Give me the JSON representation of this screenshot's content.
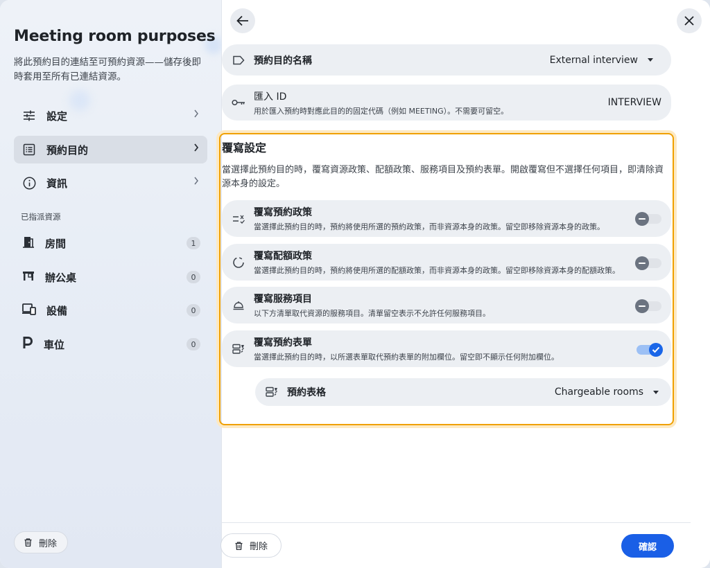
{
  "sidebar": {
    "title": "Meeting room purposes",
    "description": "將此預約目的連結至可預約資源——儲存後即時套用至所有已連結資源。",
    "nav": [
      {
        "label": "設定",
        "icon": "sliders-icon"
      },
      {
        "label": "預約目的",
        "icon": "list-icon"
      },
      {
        "label": "資訊",
        "icon": "info-icon"
      }
    ],
    "section_label": "已指派資源",
    "resources": [
      {
        "label": "房間",
        "count": "1",
        "icon": "room-icon"
      },
      {
        "label": "辦公桌",
        "count": "0",
        "icon": "desk-icon"
      },
      {
        "label": "設備",
        "count": "0",
        "icon": "devices-icon"
      },
      {
        "label": "車位",
        "count": "0",
        "icon": "parking-icon"
      }
    ],
    "delete_label": "刪除"
  },
  "main": {
    "purpose_name": {
      "label": "預約目的名稱",
      "value": "External interview"
    },
    "import_id": {
      "label": "匯入 ID",
      "hint": "用於匯入預約時對應此目的的固定代碼（例如 MEETING）。不需要可留空。",
      "value": "INTERVIEW"
    },
    "override": {
      "title": "覆寫設定",
      "description": "當選擇此預約目的時，覆寫資源政策、配額政策、服務項目及預約表單。開啟覆寫但不選擇任何項目，即清除資源本身的設定。",
      "items": [
        {
          "label": "覆寫預約政策",
          "hint": "當選擇此預約目的時，預約將使用所選的預約政策，而非資源本身的政策。留空即移除資源本身的政策。",
          "enabled": false
        },
        {
          "label": "覆寫配額政策",
          "hint": "當選擇此預約目的時，預約將使用所選的配額政策，而非資源本身的政策。留空即移除資源本身的配額政策。",
          "enabled": false
        },
        {
          "label": "覆寫服務項目",
          "hint": "以下方清單取代資源的服務項目。清單留空表示不允許任何服務項目。",
          "enabled": false
        },
        {
          "label": "覆寫預約表單",
          "hint": "當選擇此預約目的時，以所選表單取代預約表單的附加欄位。留空即不顯示任何附加欄位。",
          "enabled": true
        }
      ],
      "form": {
        "label": "預約表格",
        "value": "Chargeable rooms"
      }
    },
    "footer": {
      "delete_label": "刪除",
      "confirm_label": "確認"
    }
  },
  "colors": {
    "accent": "#1a5fe6",
    "highlight_border": "#f0a000"
  }
}
